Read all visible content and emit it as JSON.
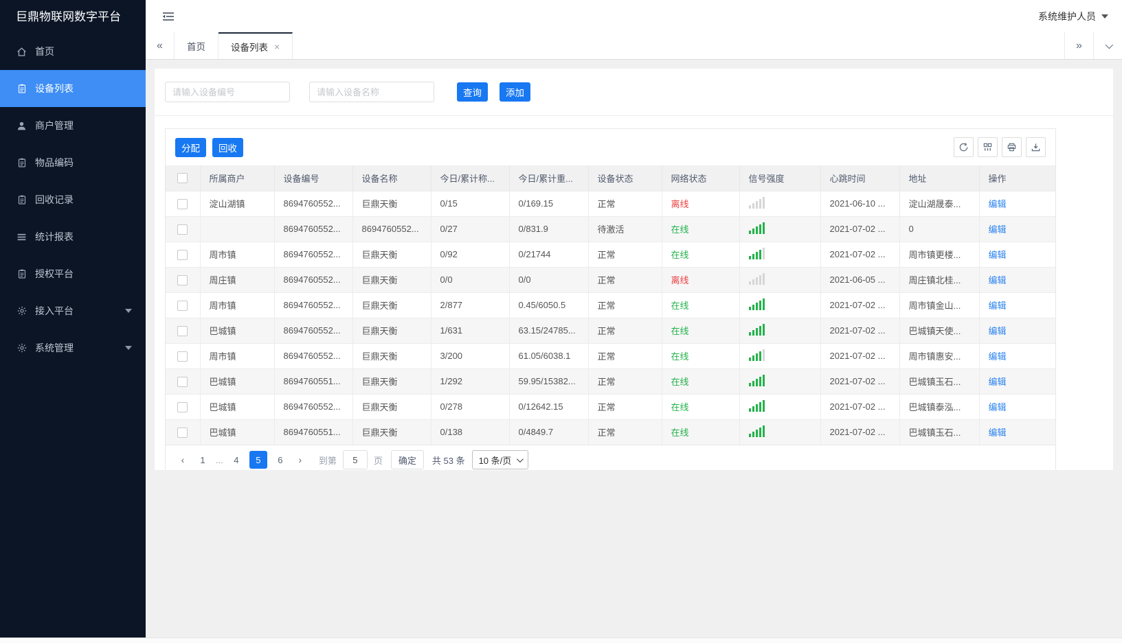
{
  "app": {
    "title": "巨鼎物联网数字平台",
    "user": "系统维护人员"
  },
  "colors": {
    "sidebar_bg": "#0b1526",
    "active_menu": "#3e8ef5",
    "accent_blue": "#1778f2",
    "online_green": "#23b24b",
    "offline_red": "#ee3f3f",
    "link_blue": "#2c84ee"
  },
  "sidebar": {
    "items": [
      {
        "label": "首页",
        "icon": "home-icon",
        "active": false
      },
      {
        "label": "设备列表",
        "icon": "device-list-icon",
        "active": true
      },
      {
        "label": "商户管理",
        "icon": "merchant-icon",
        "active": false
      },
      {
        "label": "物品编码",
        "icon": "item-code-icon",
        "active": false
      },
      {
        "label": "回收记录",
        "icon": "recycle-record-icon",
        "active": false
      },
      {
        "label": "统计报表",
        "icon": "report-icon",
        "active": false
      },
      {
        "label": "授权平台",
        "icon": "auth-platform-icon",
        "active": false
      },
      {
        "label": "接入平台",
        "icon": "gear-icon",
        "active": false,
        "expandable": true
      },
      {
        "label": "系统管理",
        "icon": "gear-icon",
        "active": false,
        "expandable": true
      }
    ]
  },
  "tabs": {
    "items": [
      {
        "label": "首页",
        "active": false
      },
      {
        "label": "设备列表",
        "active": true,
        "close": "×"
      }
    ]
  },
  "filters": {
    "device_no_placeholder": "请输入设备编号",
    "device_name_placeholder": "请输入设备名称",
    "query_label": "查询",
    "add_label": "添加"
  },
  "toolbar": {
    "allocate_label": "分配",
    "recycle_label": "回收"
  },
  "table": {
    "columns": [
      "所属商户",
      "设备编号",
      "设备名称",
      "今日/累计称...",
      "今日/累计重...",
      "设备状态",
      "网络状态",
      "信号强度",
      "心跳时间",
      "地址",
      "操作"
    ],
    "rows": [
      {
        "merchant": "淀山湖镇",
        "device_no": "8694760552...",
        "device_name": "巨鼎天衡",
        "today_count": "0/15",
        "today_weight": "0/169.15",
        "device_status": "正常",
        "network_status": "离线",
        "online": false,
        "signal": 0,
        "heartbeat": "2021-06-10 ...",
        "address": "淀山湖晟泰...",
        "action": "编辑"
      },
      {
        "merchant": "",
        "device_no": "8694760552...",
        "device_name": "8694760552...",
        "today_count": "0/27",
        "today_weight": "0/831.9",
        "device_status": "待激活",
        "network_status": "在线",
        "online": true,
        "signal": 5,
        "heartbeat": "2021-07-02 ...",
        "address": "0",
        "action": "编辑"
      },
      {
        "merchant": "周市镇",
        "device_no": "8694760552...",
        "device_name": "巨鼎天衡",
        "today_count": "0/92",
        "today_weight": "0/21744",
        "device_status": "正常",
        "network_status": "在线",
        "online": true,
        "signal": 4,
        "heartbeat": "2021-07-02 ...",
        "address": "周市镇更楼...",
        "action": "编辑"
      },
      {
        "merchant": "周庄镇",
        "device_no": "8694760552...",
        "device_name": "巨鼎天衡",
        "today_count": "0/0",
        "today_weight": "0/0",
        "device_status": "正常",
        "network_status": "离线",
        "online": false,
        "signal": 0,
        "heartbeat": "2021-06-05 ...",
        "address": "周庄镇北桂...",
        "action": "编辑"
      },
      {
        "merchant": "周市镇",
        "device_no": "8694760552...",
        "device_name": "巨鼎天衡",
        "today_count": "2/877",
        "today_weight": "0.45/6050.5",
        "device_status": "正常",
        "network_status": "在线",
        "online": true,
        "signal": 5,
        "heartbeat": "2021-07-02 ...",
        "address": "周市镇金山...",
        "action": "编辑"
      },
      {
        "merchant": "巴城镇",
        "device_no": "8694760552...",
        "device_name": "巨鼎天衡",
        "today_count": "1/631",
        "today_weight": "63.15/24785...",
        "device_status": "正常",
        "network_status": "在线",
        "online": true,
        "signal": 5,
        "heartbeat": "2021-07-02 ...",
        "address": "巴城镇天使...",
        "action": "编辑"
      },
      {
        "merchant": "周市镇",
        "device_no": "8694760552...",
        "device_name": "巨鼎天衡",
        "today_count": "3/200",
        "today_weight": "61.05/6038.1",
        "device_status": "正常",
        "network_status": "在线",
        "online": true,
        "signal": 4,
        "heartbeat": "2021-07-02 ...",
        "address": "周市镇惠安...",
        "action": "编辑"
      },
      {
        "merchant": "巴城镇",
        "device_no": "8694760551...",
        "device_name": "巨鼎天衡",
        "today_count": "1/292",
        "today_weight": "59.95/15382...",
        "device_status": "正常",
        "network_status": "在线",
        "online": true,
        "signal": 5,
        "heartbeat": "2021-07-02 ...",
        "address": "巴城镇玉石...",
        "action": "编辑"
      },
      {
        "merchant": "巴城镇",
        "device_no": "8694760552...",
        "device_name": "巨鼎天衡",
        "today_count": "0/278",
        "today_weight": "0/12642.15",
        "device_status": "正常",
        "network_status": "在线",
        "online": true,
        "signal": 5,
        "heartbeat": "2021-07-02 ...",
        "address": "巴城镇泰泓...",
        "action": "编辑"
      },
      {
        "merchant": "巴城镇",
        "device_no": "8694760551...",
        "device_name": "巨鼎天衡",
        "today_count": "0/138",
        "today_weight": "0/4849.7",
        "device_status": "正常",
        "network_status": "在线",
        "online": true,
        "signal": 5,
        "heartbeat": "2021-07-02 ...",
        "address": "巴城镇玉石...",
        "action": "编辑"
      }
    ]
  },
  "pagination": {
    "pages": [
      {
        "label": "1",
        "active": false
      },
      {
        "label": "...",
        "ellipsis": true
      },
      {
        "label": "4",
        "active": false
      },
      {
        "label": "5",
        "active": true
      },
      {
        "label": "6",
        "active": false
      }
    ],
    "goto_prefix": "到第",
    "goto_value": "5",
    "goto_suffix": "页",
    "confirm_label": "确定",
    "total_text": "共 53 条",
    "page_size_text": "10 条/页"
  }
}
